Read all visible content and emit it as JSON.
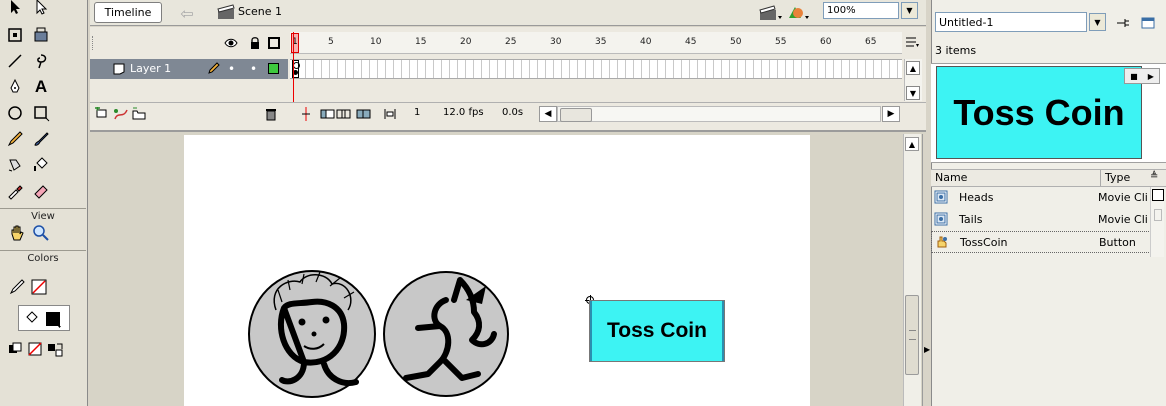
{
  "tools_panel": {
    "view_label": "View",
    "colors_label": "Colors"
  },
  "timeline": {
    "tab_label": "Timeline",
    "scene_label": "Scene 1",
    "zoom": "100%",
    "layer_name": "Layer 1",
    "frame_numbers": [
      "1",
      "5",
      "10",
      "15",
      "20",
      "25",
      "30",
      "35",
      "40",
      "45",
      "50",
      "55",
      "60",
      "65"
    ],
    "current_frame": "1",
    "fps": "12.0 fps",
    "elapsed": "0.0s"
  },
  "stage": {
    "button_text": "Toss Coin"
  },
  "library": {
    "document": "Untitled-1",
    "item_count": "3 items",
    "preview_text": "Toss Coin",
    "col_name": "Name",
    "col_type": "Type",
    "items": [
      {
        "name": "Heads",
        "type": "Movie Clip"
      },
      {
        "name": "Tails",
        "type": "Movie Clip"
      },
      {
        "name": "TossCoin",
        "type": "Button"
      }
    ]
  },
  "colors": {
    "button_fill": "#3df3f3",
    "layer_highlight": "#7f8894",
    "playhead": "#dd0000"
  }
}
